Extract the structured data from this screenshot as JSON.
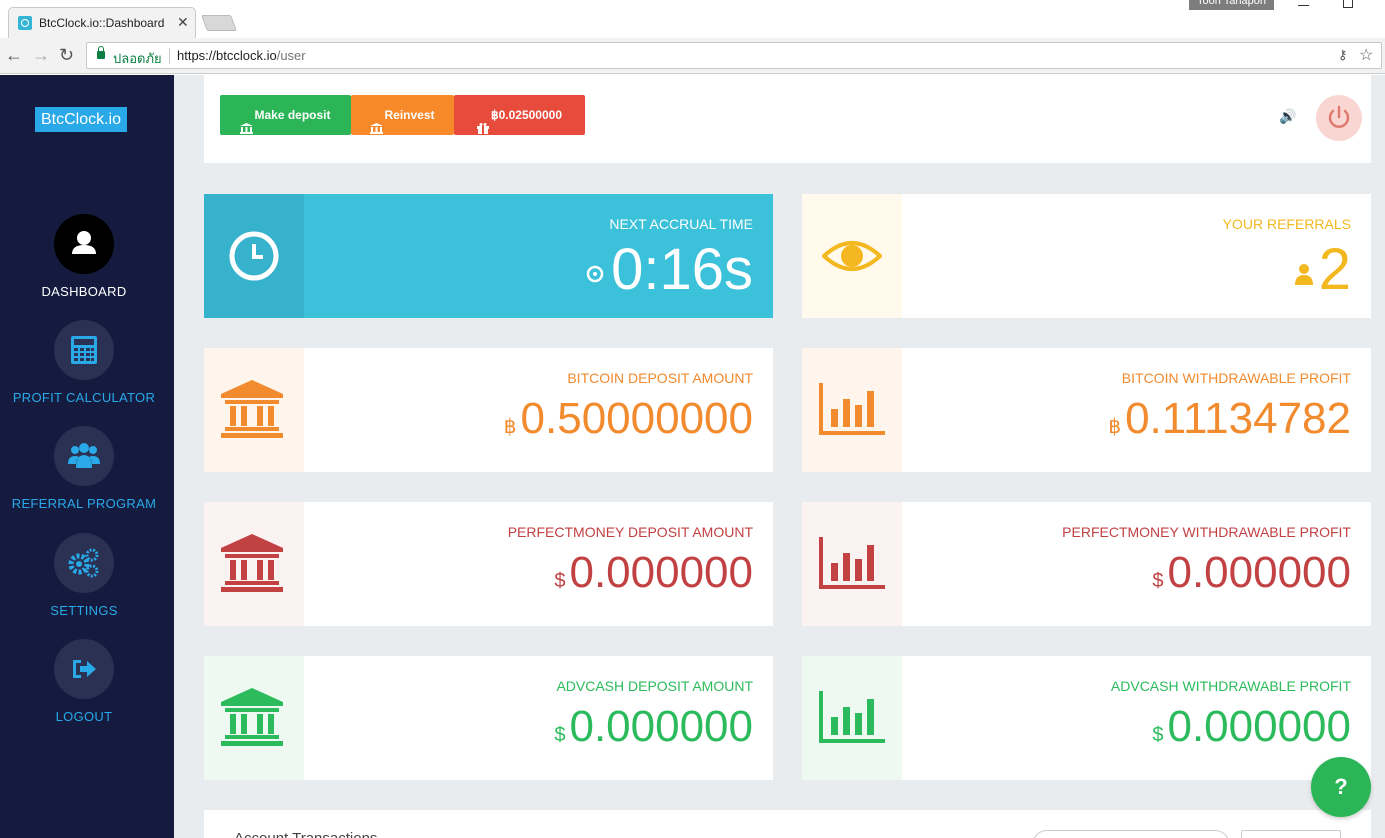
{
  "browser": {
    "tab_title": "BtcClock.io::Dashboard",
    "tab_close": "✕",
    "user_chip": "Toon Tanapon",
    "secure_label": "ปลอดภัย",
    "url_scheme_host": "https://btcclock.io",
    "url_path": "/user",
    "back": "←",
    "forward": "→",
    "reload": "↻",
    "key_icon": "⚷",
    "star_icon": "☆"
  },
  "sidebar": {
    "brand": "BtcClock.io",
    "items": [
      {
        "label": "DASHBOARD",
        "icon": "user-icon",
        "active": true
      },
      {
        "label": "PROFIT CALCULATOR",
        "icon": "calculator-icon",
        "active": false
      },
      {
        "label": "REFERRAL PROGRAM",
        "icon": "users-icon",
        "active": false
      },
      {
        "label": "SETTINGS",
        "icon": "gears-icon",
        "active": false
      },
      {
        "label": "LOGOUT",
        "icon": "sign-out-icon",
        "active": false
      }
    ]
  },
  "topbar": {
    "deposit_label": "Make deposit",
    "reinvest_label": "Reinvest",
    "bonus_label": "฿0.02500000",
    "speaker_icon": "🔊"
  },
  "cards": {
    "accrual": {
      "title": "NEXT ACCRUAL TIME",
      "value": "0:16s"
    },
    "referrals": {
      "title": "YOUR REFERRALS",
      "value": "2"
    },
    "btc_deposit": {
      "title": "BITCOIN DEPOSIT AMOUNT",
      "symbol": "฿",
      "value": "0.50000000"
    },
    "btc_profit": {
      "title": "BITCOIN WITHDRAWABLE PROFIT",
      "symbol": "฿",
      "value": "0.11134782"
    },
    "pm_deposit": {
      "title": "PERFECTMONEY DEPOSIT AMOUNT",
      "symbol": "$",
      "value": "0.000000"
    },
    "pm_profit": {
      "title": "PERFECTMONEY WITHDRAWABLE PROFIT",
      "symbol": "$",
      "value": "0.000000"
    },
    "adv_deposit": {
      "title": "ADVCASH DEPOSIT AMOUNT",
      "symbol": "$",
      "value": "0.000000"
    },
    "adv_profit": {
      "title": "ADVCASH WITHDRAWABLE PROFIT",
      "symbol": "$",
      "value": "0.000000"
    }
  },
  "bottom": {
    "title": "Account Transactions"
  },
  "help": {
    "label": "?"
  },
  "colors": {
    "sidebar_bg": "#141b3f",
    "accent_blue": "#29a9e8",
    "cyan": "#3cc1da",
    "yellow": "#f3b81f",
    "orange": "#f28a2e",
    "red": "#c24143",
    "green": "#2cbb5c"
  }
}
